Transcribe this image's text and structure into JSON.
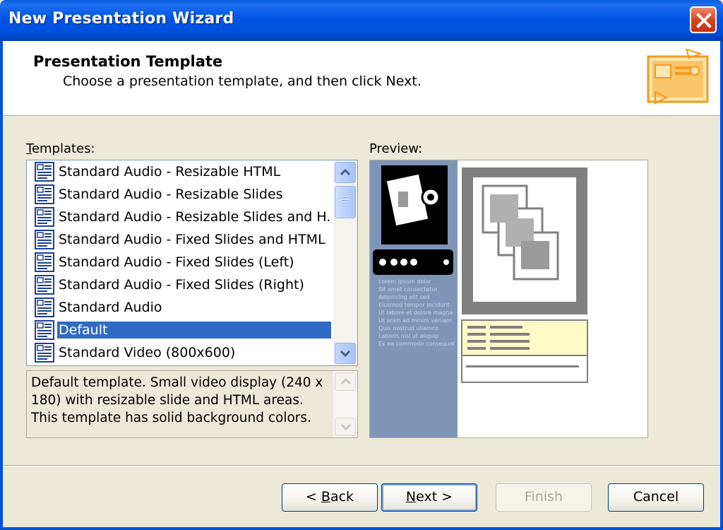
{
  "window": {
    "title": "New Presentation Wizard"
  },
  "header": {
    "title": "Presentation Template",
    "subtitle": "Choose a presentation template, and then click Next."
  },
  "templates": {
    "label_first": "T",
    "label_rest": "emplates:",
    "items": [
      "Standard Audio - Resizable HTML",
      "Standard Audio - Resizable Slides",
      "Standard Audio - Resizable Slides and H...",
      "Standard Audio - Fixed Slides and HTML",
      "Standard Audio - Fixed Slides (Left)",
      "Standard Audio - Fixed Slides (Right)",
      "Standard Audio",
      "Default",
      "Standard Video (800x600)"
    ],
    "selected_index": 7
  },
  "description": "Default template. Small video display (240 x 180) with resizable slide and HTML areas. This template has solid background colors.",
  "preview": {
    "label": "Preview:",
    "sample_text": [
      "Lorem ipsum dolor",
      "Sit amet consectetur",
      "Adipiscing elit sed",
      "Eiusmod tempor incidunt",
      "Ut labore et dolore magna",
      "Ut enim ad minim veniam",
      "Quis nostrud ullamco",
      "Laboris nisi ut aliquip",
      "Ex ea commodo consequat"
    ],
    "colors": {
      "sidebar": "#7f95b8",
      "frame": "#808080",
      "html_area": "#fefbc8"
    }
  },
  "buttons": {
    "back_prefix": "< ",
    "back_u": "B",
    "back_rest": "ack",
    "next_u": "N",
    "next_rest": "ext >",
    "finish": "Finish",
    "cancel": "Cancel"
  },
  "colors": {
    "titlebar": "#0054e3",
    "selection": "#316ac5",
    "dialog_bg": "#ece9d8"
  },
  "icons": [
    "close-icon",
    "presentation-icon",
    "template-icon",
    "scroll-up-icon",
    "scroll-down-icon",
    "camera-icon"
  ]
}
